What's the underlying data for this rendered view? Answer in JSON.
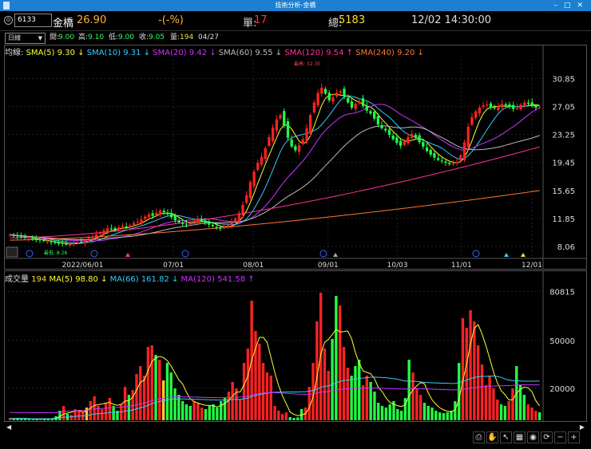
{
  "window": {
    "title": "技術分析-金橋"
  },
  "quote": {
    "code": "6133",
    "name": "金橋",
    "price": "26.90",
    "change": "-(-%)",
    "unit_label": "單:",
    "unit_value": "17",
    "total_label": "總:",
    "total_value": "5183",
    "datetime": "12/02 14:30:00"
  },
  "ohlc": {
    "period": "日線",
    "open_label": "開:",
    "open": "9.00",
    "high_label": "高:",
    "high": "9.10",
    "low_label": "低:",
    "low": "9.00",
    "close_label": "收:",
    "close": "9.05",
    "vol_label": "量:",
    "vol": "194",
    "date": "04/27"
  },
  "ma_legend": {
    "prefix": "均線:",
    "items": [
      {
        "label": "SMA(5) 9.30",
        "arrow": "↓",
        "color": "#ffff33"
      },
      {
        "label": "SMA(10) 9.31",
        "arrow": "↓",
        "color": "#33ccff"
      },
      {
        "label": "SMA(20) 9.42",
        "arrow": "↓",
        "color": "#cc33ff"
      },
      {
        "label": "SMA(60) 9.55",
        "arrow": "↓",
        "color": "#bbbbbb"
      },
      {
        "label": "SMA(120) 9.54",
        "arrow": "↑",
        "color": "#ff3399"
      },
      {
        "label": "SMA(240) 9.20",
        "arrow": "↓",
        "color": "#ff7733"
      }
    ]
  },
  "vol_legend": {
    "prefix": "成交量",
    "value": "194",
    "items": [
      {
        "label": "MA(5) 98.80",
        "arrow": "↓",
        "color": "#ffff33"
      },
      {
        "label": "MA(66) 161.82",
        "arrow": "↓",
        "color": "#33ccff"
      },
      {
        "label": "MA(120) 541.58",
        "arrow": "↑",
        "color": "#cc33ff"
      }
    ]
  },
  "chart_data": [
    {
      "type": "candlestick",
      "title": "",
      "yticks": [
        30.85,
        27.05,
        23.25,
        19.45,
        15.65,
        11.85,
        8.06
      ],
      "ylim": [
        7.5,
        33.5
      ],
      "xticks": [
        "2022/06/01",
        "07/01",
        "08/01",
        "09/01",
        "10/03",
        "11/01",
        "12/01"
      ],
      "annotations": {
        "high": "最高: 32.35",
        "low": "最低: 8.26"
      },
      "closes": [
        9.6,
        9.5,
        9.4,
        9.3,
        9.2,
        9.1,
        9.0,
        8.9,
        8.9,
        8.8,
        8.7,
        8.6,
        8.5,
        8.4,
        8.4,
        8.3,
        8.4,
        8.5,
        8.6,
        8.7,
        8.9,
        9.2,
        9.4,
        9.7,
        9.9,
        10.2,
        10.5,
        10.4,
        10.3,
        10.6,
        10.8,
        10.7,
        10.9,
        11.2,
        11.4,
        11.7,
        12.1,
        12.4,
        12.2,
        12.6,
        12.9,
        12.7,
        12.4,
        12.0,
        11.6,
        11.3,
        11.1,
        11.0,
        11.2,
        11.5,
        11.8,
        11.5,
        11.2,
        11.0,
        10.8,
        10.6,
        10.5,
        10.7,
        10.9,
        11.3,
        11.8,
        12.6,
        13.7,
        15.0,
        16.8,
        18.2,
        19.4,
        20.2,
        21.4,
        22.9,
        24.2,
        25.3,
        25.9,
        24.4,
        22.8,
        21.6,
        21.1,
        21.8,
        22.6,
        24.1,
        25.9,
        27.6,
        28.9,
        29.6,
        28.8,
        27.9,
        28.3,
        28.9,
        29.1,
        28.4,
        27.6,
        26.9,
        27.4,
        27.8,
        27.1,
        26.5,
        26.1,
        25.4,
        24.6,
        24.1,
        23.8,
        23.2,
        22.6,
        22.1,
        21.7,
        22.3,
        22.9,
        23.3,
        22.8,
        22.2,
        21.6,
        21.0,
        20.5,
        20.1,
        19.8,
        19.6,
        19.4,
        19.2,
        19.3,
        19.5,
        20.4,
        22.2,
        24.3,
        25.6,
        26.4,
        26.9,
        27.2,
        27.3,
        27.0,
        26.8,
        27.1,
        27.4,
        27.2,
        27.0,
        26.7,
        26.9,
        27.3,
        27.6,
        27.4,
        27.2,
        26.9,
        26.9
      ],
      "series": [
        {
          "name": "SMA(5)",
          "color": "#ffff33"
        },
        {
          "name": "SMA(10)",
          "color": "#33ccff"
        },
        {
          "name": "SMA(20)",
          "color": "#cc33ff"
        },
        {
          "name": "SMA(60)",
          "color": "#bbbbbb"
        },
        {
          "name": "SMA(120)",
          "color": "#ff3399"
        },
        {
          "name": "SMA(240)",
          "color": "#ff7733"
        }
      ]
    },
    {
      "type": "bar",
      "title": "",
      "yticks": [
        "80815",
        "50000",
        "20000"
      ],
      "ylim": [
        0,
        83000
      ],
      "volumes": [
        1200,
        900,
        1500,
        800,
        1100,
        700,
        600,
        900,
        1200,
        1000,
        800,
        1300,
        2500,
        6000,
        9000,
        4000,
        3500,
        7000,
        6500,
        5000,
        8000,
        12000,
        15000,
        9000,
        7000,
        11000,
        14000,
        9000,
        6000,
        10000,
        21000,
        16000,
        19000,
        29000,
        34000,
        28000,
        46000,
        47000,
        41000,
        38000,
        25000,
        36000,
        30000,
        20000,
        16000,
        12000,
        10000,
        9000,
        12000,
        11000,
        8000,
        7000,
        9000,
        10000,
        8000,
        12000,
        14000,
        18000,
        24000,
        20000,
        13000,
        36000,
        45000,
        75000,
        56000,
        48000,
        36000,
        30000,
        28000,
        9000,
        6000,
        4000,
        5000,
        2000,
        1500,
        1800,
        7000,
        8000,
        21000,
        36000,
        62000,
        80000,
        45000,
        31000,
        51000,
        78000,
        72000,
        46000,
        33000,
        28000,
        34000,
        38000,
        22000,
        28000,
        24000,
        18000,
        11000,
        9000,
        8000,
        10000,
        12000,
        7000,
        6000,
        14000,
        38000,
        30000,
        20000,
        16000,
        11000,
        9000,
        8000,
        6000,
        5000,
        4500,
        5000,
        6000,
        12000,
        36000,
        64000,
        58000,
        69000,
        62000,
        47000,
        35000,
        22000,
        28000,
        20000,
        13000,
        10000,
        9000,
        12000,
        20000,
        34000,
        22000,
        16000,
        10000,
        8000,
        6000,
        5000
      ],
      "series": [
        {
          "name": "MA(5)",
          "color": "#ffff33"
        },
        {
          "name": "MA(66)",
          "color": "#33ccff"
        },
        {
          "name": "MA(120)",
          "color": "#cc33ff"
        }
      ]
    }
  ],
  "toolbar": {
    "icons": [
      "print-icon",
      "hand-icon",
      "cursor-icon",
      "grid-icon",
      "eye-icon",
      "refresh-icon",
      "minus-icon",
      "plus-icon"
    ]
  }
}
